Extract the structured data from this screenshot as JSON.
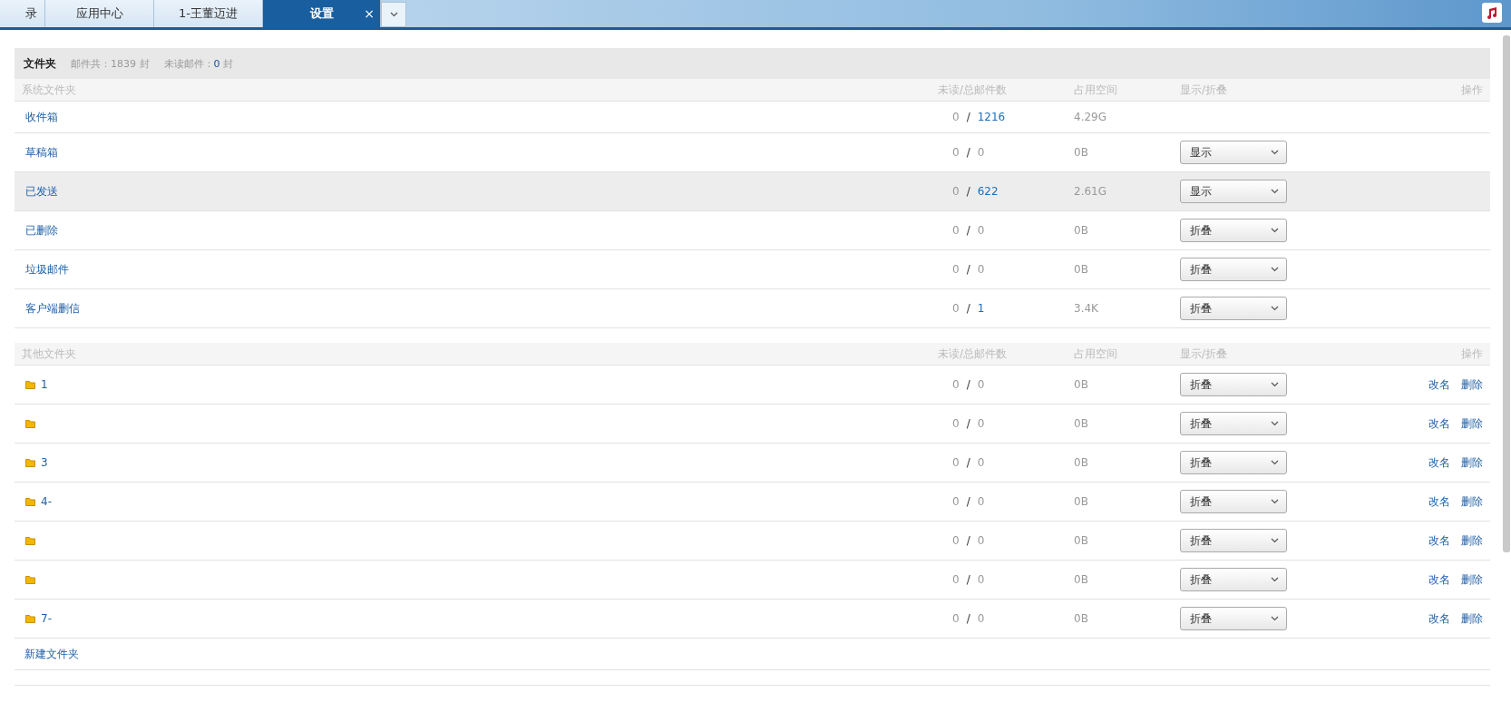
{
  "tabs": [
    {
      "label": "录",
      "selected": false
    },
    {
      "label": "应用中心",
      "selected": false
    },
    {
      "label": "1-王董迈进",
      "selected": false
    },
    {
      "label": "设置",
      "selected": true,
      "close_label": "×"
    }
  ],
  "count_separator": "/",
  "summary": {
    "title": "文件夹",
    "total_label": "邮件共：",
    "total": "1839",
    "total_unit": "封",
    "unread_label": "未读邮件：",
    "unread": "0",
    "unread_unit": "封"
  },
  "system_section": {
    "columns": [
      "系统文件夹",
      "未读/总邮件数",
      "占用空间",
      "显示/折叠",
      "操作"
    ],
    "rows": [
      {
        "name": "收件箱",
        "unread": "0",
        "total": "1216",
        "total_linked": true,
        "size": "4.29G",
        "selected": false
      },
      {
        "name": "草稿箱",
        "unread": "0",
        "total": "0",
        "total_linked": false,
        "size": "0B",
        "display": "显示",
        "selected": false
      },
      {
        "name": "已发送",
        "unread": "0",
        "total": "622",
        "total_linked": true,
        "size": "2.61G",
        "display": "显示",
        "selected": true
      },
      {
        "name": "已删除",
        "unread": "0",
        "total": "0",
        "total_linked": false,
        "size": "0B",
        "display": "折叠",
        "selected": false
      },
      {
        "name": "垃圾邮件",
        "unread": "0",
        "total": "0",
        "total_linked": false,
        "size": "0B",
        "display": "折叠",
        "selected": false
      },
      {
        "name": "客户端删信",
        "unread": "0",
        "total": "1",
        "total_linked": true,
        "size": "3.4K",
        "display": "折叠",
        "selected": false
      }
    ]
  },
  "other_section": {
    "columns": [
      "其他文件夹",
      "未读/总邮件数",
      "占用空间",
      "显示/折叠",
      "操作"
    ],
    "rows": [
      {
        "name": "1",
        "unread": "0",
        "total": "0",
        "total_linked": false,
        "size": "0B",
        "display": "折叠",
        "actions": [
          "改名",
          "删除"
        ]
      },
      {
        "unread": "0",
        "total": "0",
        "total_linked": false,
        "size": "0B",
        "display": "折叠",
        "actions": [
          "改名",
          "删除"
        ]
      },
      {
        "name": "3",
        "unread": "0",
        "total": "0",
        "total_linked": false,
        "size": "0B",
        "display": "折叠",
        "actions": [
          "改名",
          "删除"
        ]
      },
      {
        "name": "4-",
        "unread": "0",
        "total": "0",
        "total_linked": false,
        "size": "0B",
        "display": "折叠",
        "actions": [
          "改名",
          "删除"
        ]
      },
      {
        "unread": "0",
        "total": "0",
        "total_linked": false,
        "size": "0B",
        "display": "折叠",
        "actions": [
          "改名",
          "删除"
        ]
      },
      {
        "unread": "0",
        "total": "0",
        "total_linked": false,
        "size": "0B",
        "display": "折叠",
        "actions": [
          "改名",
          "删除"
        ]
      },
      {
        "name": "7-",
        "unread": "0",
        "total": "0",
        "total_linked": false,
        "size": "0B",
        "display": "折叠",
        "actions": [
          "改名",
          "删除"
        ]
      }
    ],
    "new_folder": "新建文件夹"
  }
}
